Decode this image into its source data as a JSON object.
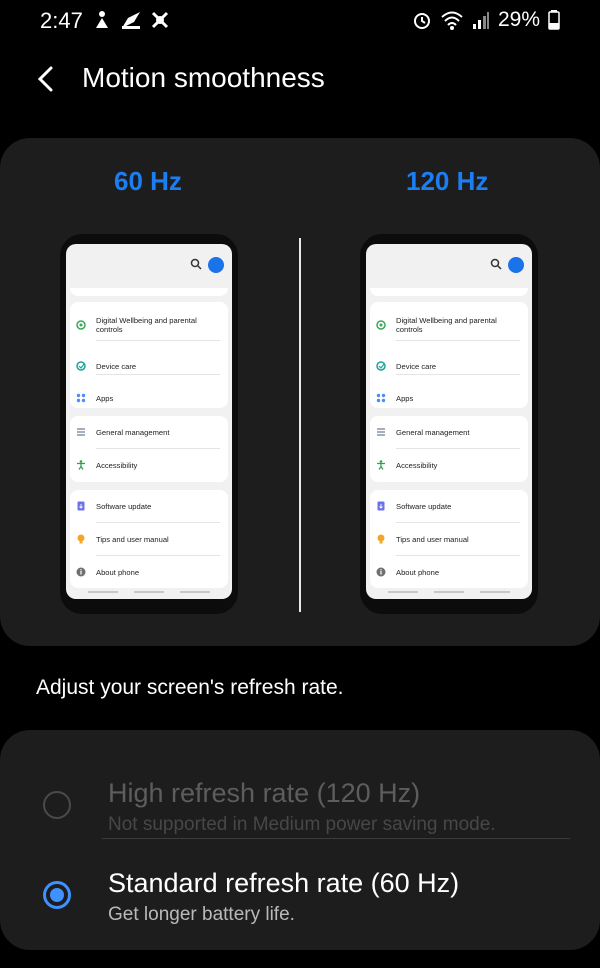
{
  "status_bar": {
    "time": "2:47",
    "battery": "29%"
  },
  "header": {
    "title": "Motion smoothness"
  },
  "preview": {
    "left_label": "60 Hz",
    "right_label": "120 Hz",
    "phone_items": [
      {
        "label": "Digital Wellbeing and parental controls",
        "icon": "digital-wellbeing-icon",
        "color": "#3aa757"
      },
      {
        "label": "Device care",
        "icon": "device-care-icon",
        "color": "#1ca39a"
      },
      {
        "label": "Apps",
        "icon": "apps-icon",
        "color": "#4f8ef7"
      },
      {
        "label": "General management",
        "icon": "general-management-icon",
        "color": "#707c94"
      },
      {
        "label": "Accessibility",
        "icon": "accessibility-icon",
        "color": "#2e9f4a"
      },
      {
        "label": "Software update",
        "icon": "software-update-icon",
        "color": "#6b73e8"
      },
      {
        "label": "Tips and user manual",
        "icon": "tips-icon",
        "color": "#f4a42a"
      },
      {
        "label": "About phone",
        "icon": "about-phone-icon",
        "color": "#707070"
      }
    ]
  },
  "description": "Adjust your screen's refresh rate.",
  "options": [
    {
      "title": "High refresh rate (120 Hz)",
      "subtitle": "Not supported in Medium power saving mode.",
      "selected": false,
      "enabled": false
    },
    {
      "title": "Standard refresh rate (60 Hz)",
      "subtitle": "Get longer battery life.",
      "selected": true,
      "enabled": true
    }
  ],
  "colors": {
    "accent": "#1b7ef2",
    "radio_selected": "#3e91ff",
    "disabled_text": "#5d5d5d",
    "card_background": "#1d1d1d"
  }
}
